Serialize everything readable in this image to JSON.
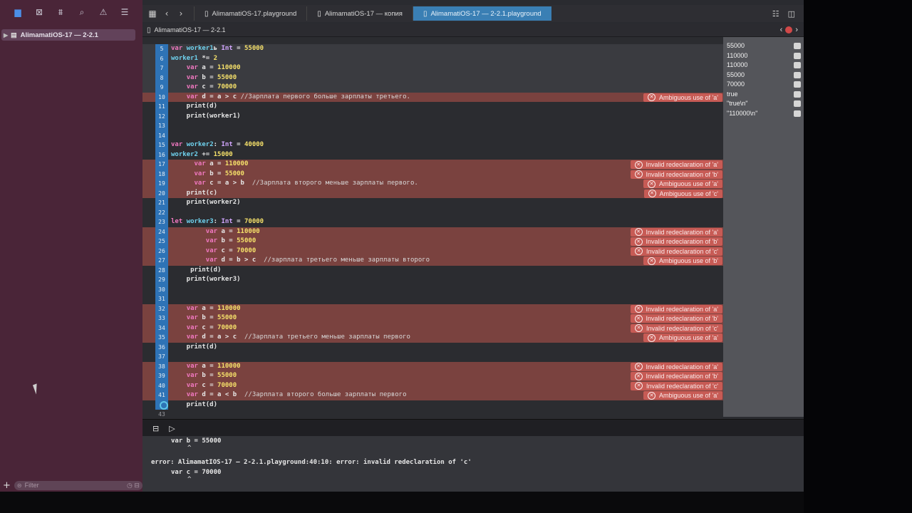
{
  "nav": {
    "item": "AlimamatiOS-17 — 2-2.1",
    "filter_placeholder": "Filter"
  },
  "tabs": [
    {
      "label": "AlimamatiOS-17.playground"
    },
    {
      "label": "AlimamatiOS-17 — копия"
    },
    {
      "label": "AlimamatiOS-17 — 2-2.1.playground"
    }
  ],
  "jumpbar": {
    "title": "AlimamatiOS-17 — 2-2.1"
  },
  "lines": [
    {
      "n": "5",
      "segs": [
        [
          "kw",
          "var "
        ],
        [
          "var",
          "worker1"
        ],
        [
          "",
          "ь "
        ],
        [
          "typ",
          "Int"
        ],
        [
          "",
          " = "
        ],
        [
          "num",
          "55000"
        ]
      ],
      "style": "hl"
    },
    {
      "n": "6",
      "segs": [
        [
          "var",
          "worker1"
        ],
        [
          "",
          " *= "
        ],
        [
          "num",
          "2"
        ]
      ],
      "style": "hl"
    },
    {
      "n": "7",
      "segs": [
        [
          "",
          "    "
        ],
        [
          "kw",
          "var"
        ],
        [
          "",
          " a = "
        ],
        [
          "num",
          "110000"
        ]
      ],
      "style": "hl"
    },
    {
      "n": "8",
      "segs": [
        [
          "",
          "    "
        ],
        [
          "kw",
          "var"
        ],
        [
          "",
          " b = "
        ],
        [
          "num",
          "55000"
        ]
      ],
      "style": "hl"
    },
    {
      "n": "9",
      "segs": [
        [
          "",
          "    "
        ],
        [
          "kw",
          "var"
        ],
        [
          "",
          " c = "
        ],
        [
          "num",
          "70000"
        ]
      ],
      "style": "hl"
    },
    {
      "n": "10",
      "segs": [
        [
          "",
          "    "
        ],
        [
          "kw",
          "var"
        ],
        [
          "",
          " d = a > c "
        ],
        [
          "cmt",
          "//Зарплата первого больше зарплаты третьего."
        ]
      ],
      "style": "err"
    },
    {
      "n": "11",
      "segs": [
        [
          "",
          "    print(d)"
        ]
      ],
      "style": ""
    },
    {
      "n": "12",
      "segs": [
        [
          "",
          "    print(worker1)"
        ]
      ],
      "style": ""
    },
    {
      "n": "13",
      "segs": [],
      "style": ""
    },
    {
      "n": "14",
      "segs": [],
      "style": ""
    },
    {
      "n": "15",
      "segs": [
        [
          "kw",
          "var "
        ],
        [
          "var",
          "worker2"
        ],
        [
          "",
          ": "
        ],
        [
          "typ",
          "Int"
        ],
        [
          "",
          " = "
        ],
        [
          "num",
          "40000"
        ]
      ],
      "style": ""
    },
    {
      "n": "16",
      "segs": [
        [
          "var",
          "worker2"
        ],
        [
          "",
          " += "
        ],
        [
          "num",
          "15000"
        ]
      ],
      "style": ""
    },
    {
      "n": "17",
      "segs": [
        [
          "",
          "      "
        ],
        [
          "kw",
          "var"
        ],
        [
          "",
          " a = "
        ],
        [
          "num",
          "110000"
        ]
      ],
      "style": "err"
    },
    {
      "n": "18",
      "segs": [
        [
          "",
          "      "
        ],
        [
          "kw",
          "var"
        ],
        [
          "",
          " b = "
        ],
        [
          "num",
          "55000"
        ]
      ],
      "style": "err"
    },
    {
      "n": "19",
      "segs": [
        [
          "",
          "      "
        ],
        [
          "kw",
          "var"
        ],
        [
          "",
          " c = a > b  "
        ],
        [
          "cmt",
          "//Зарплата второго меньше зарплаты первого."
        ]
      ],
      "style": "err"
    },
    {
      "n": "20",
      "segs": [
        [
          "",
          "    print(c)"
        ]
      ],
      "style": "err"
    },
    {
      "n": "21",
      "segs": [
        [
          "",
          "    print(worker2)"
        ]
      ],
      "style": ""
    },
    {
      "n": "22",
      "segs": [],
      "style": ""
    },
    {
      "n": "23",
      "segs": [
        [
          "kw",
          "let "
        ],
        [
          "var",
          "worker3"
        ],
        [
          "",
          ": "
        ],
        [
          "typ",
          "Int"
        ],
        [
          "",
          " = "
        ],
        [
          "num",
          "70000"
        ]
      ],
      "style": ""
    },
    {
      "n": "24",
      "segs": [
        [
          "",
          "         "
        ],
        [
          "kw",
          "var"
        ],
        [
          "",
          " a = "
        ],
        [
          "num",
          "110000"
        ]
      ],
      "style": "err"
    },
    {
      "n": "25",
      "segs": [
        [
          "",
          "         "
        ],
        [
          "kw",
          "var"
        ],
        [
          "",
          " b = "
        ],
        [
          "num",
          "55000"
        ]
      ],
      "style": "err"
    },
    {
      "n": "26",
      "segs": [
        [
          "",
          "         "
        ],
        [
          "kw",
          "var"
        ],
        [
          "",
          " c = "
        ],
        [
          "num",
          "70000"
        ]
      ],
      "style": "err"
    },
    {
      "n": "27",
      "segs": [
        [
          "",
          "         "
        ],
        [
          "kw",
          "var"
        ],
        [
          "",
          " d = b > c  "
        ],
        [
          "cmt",
          "//зарплата третьего меньше зарплаты второго"
        ]
      ],
      "style": "err"
    },
    {
      "n": "28",
      "segs": [
        [
          "",
          "     print(d)"
        ]
      ],
      "style": ""
    },
    {
      "n": "29",
      "segs": [
        [
          "",
          "    print(worker3)"
        ]
      ],
      "style": ""
    },
    {
      "n": "30",
      "segs": [],
      "style": ""
    },
    {
      "n": "31",
      "segs": [],
      "style": ""
    },
    {
      "n": "32",
      "segs": [
        [
          "",
          "    "
        ],
        [
          "kw",
          "var"
        ],
        [
          "",
          " a = "
        ],
        [
          "num",
          "110000"
        ]
      ],
      "style": "err"
    },
    {
      "n": "33",
      "segs": [
        [
          "",
          "    "
        ],
        [
          "kw",
          "var"
        ],
        [
          "",
          " b = "
        ],
        [
          "num",
          "55000"
        ]
      ],
      "style": "err"
    },
    {
      "n": "34",
      "segs": [
        [
          "",
          "    "
        ],
        [
          "kw",
          "var"
        ],
        [
          "",
          " c = "
        ],
        [
          "num",
          "70000"
        ]
      ],
      "style": "err"
    },
    {
      "n": "35",
      "segs": [
        [
          "",
          "    "
        ],
        [
          "kw",
          "var"
        ],
        [
          "",
          " d = a > c  "
        ],
        [
          "cmt",
          "//Зарплата третьего меньше зарплаты первого"
        ]
      ],
      "style": "err"
    },
    {
      "n": "36",
      "segs": [
        [
          "",
          "    print(d)"
        ]
      ],
      "style": ""
    },
    {
      "n": "37",
      "segs": [],
      "style": ""
    },
    {
      "n": "38",
      "segs": [
        [
          "",
          "    "
        ],
        [
          "kw",
          "var"
        ],
        [
          "",
          " a = "
        ],
        [
          "num",
          "110000"
        ]
      ],
      "style": "err"
    },
    {
      "n": "39",
      "segs": [
        [
          "",
          "    "
        ],
        [
          "kw",
          "var"
        ],
        [
          "",
          " b = "
        ],
        [
          "num",
          "55000"
        ]
      ],
      "style": "err"
    },
    {
      "n": "40",
      "segs": [
        [
          "",
          "    "
        ],
        [
          "kw",
          "var"
        ],
        [
          "",
          " c = "
        ],
        [
          "num",
          "70000"
        ]
      ],
      "style": "err"
    },
    {
      "n": "41",
      "segs": [
        [
          "",
          "    "
        ],
        [
          "kw",
          "var"
        ],
        [
          "",
          " d = a < b  "
        ],
        [
          "cmt",
          "//Зарплата второго больше зарплаты первого"
        ]
      ],
      "style": "err"
    },
    {
      "n": "",
      "segs": [
        [
          "",
          "    print(d)"
        ]
      ],
      "style": ""
    },
    {
      "n": "43",
      "segs": [],
      "style": "plain"
    }
  ],
  "errors": [
    {
      "line": 5,
      "text": "Ambiguous use of 'a'"
    },
    {
      "line": 12,
      "text": "Invalid redeclaration of 'a'"
    },
    {
      "line": 13,
      "text": "Invalid redeclaration of 'b'"
    },
    {
      "line": 14,
      "text": "Ambiguous use of 'a'"
    },
    {
      "line": 15,
      "text": "Ambiguous use of 'c'"
    },
    {
      "line": 19,
      "text": "Invalid redeclaration of 'a'"
    },
    {
      "line": 20,
      "text": "Invalid redeclaration of 'b'"
    },
    {
      "line": 21,
      "text": "Invalid redeclaration of 'c'"
    },
    {
      "line": 22,
      "text": "Ambiguous use of 'b'"
    },
    {
      "line": 27,
      "text": "Invalid redeclaration of 'a'"
    },
    {
      "line": 28,
      "text": "Invalid redeclaration of 'b'"
    },
    {
      "line": 29,
      "text": "Invalid redeclaration of 'c'"
    },
    {
      "line": 30,
      "text": "Ambiguous use of 'a'"
    },
    {
      "line": 33,
      "text": "Invalid redeclaration of 'a'"
    },
    {
      "line": 34,
      "text": "Invalid redeclaration of 'b'"
    },
    {
      "line": 35,
      "text": "Invalid redeclaration of 'c'"
    },
    {
      "line": 36,
      "text": "Ambiguous use of 'a'"
    }
  ],
  "results": [
    "55000",
    "110000",
    "110000",
    "55000",
    "70000",
    "true",
    "\"true\\n\"",
    "\"110000\\n\""
  ],
  "console": {
    "line1": "var b = 55000",
    "line2": "error: AlimamatIOS-17 — 2-2.1.playground:40:10: error: invalid redeclaration of 'c'",
    "line3": "var c = 70000"
  },
  "colors": {
    "sidebar": "#4a2538",
    "error_line": "#7a423f",
    "error_badge": "#c75b55",
    "active_tab": "#3a7fb4",
    "gutter_run": "#2e73b6"
  }
}
